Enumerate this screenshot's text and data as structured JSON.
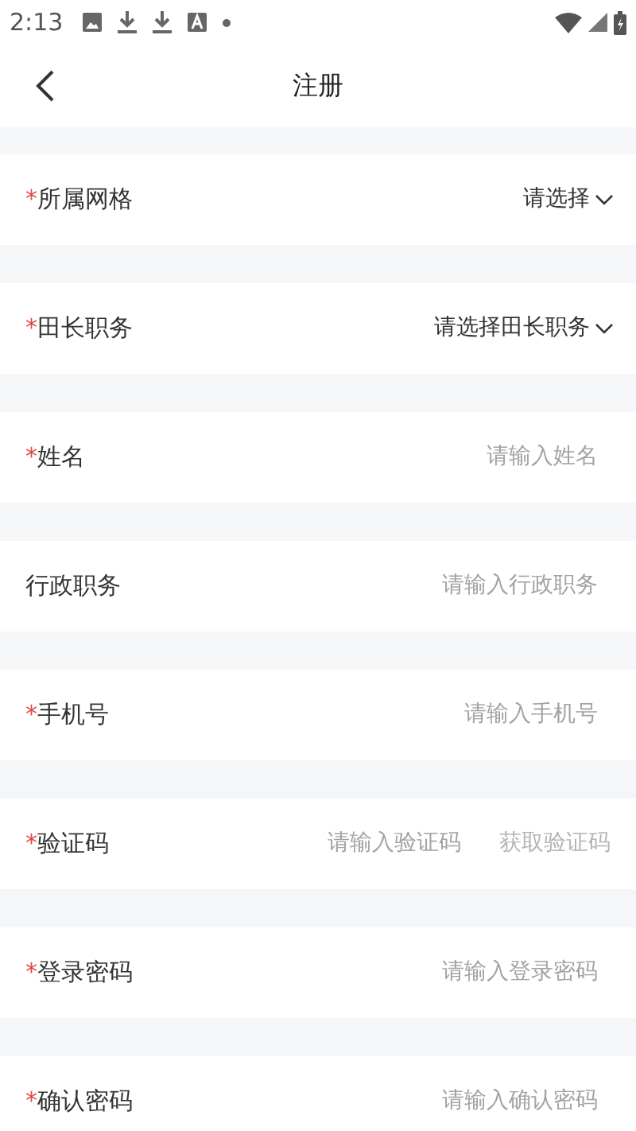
{
  "status_bar": {
    "time": "2:13"
  },
  "header": {
    "title": "注册"
  },
  "fields": [
    {
      "kind": "select",
      "required_mark": "*",
      "label": "所属网格",
      "value": "请选择"
    },
    {
      "kind": "select",
      "required_mark": "*",
      "label": "田长职务",
      "value": "请选择田长职务"
    },
    {
      "kind": "input",
      "required_mark": "*",
      "label": "姓名",
      "placeholder": "请输入姓名"
    },
    {
      "kind": "input",
      "label": "行政职务",
      "placeholder": "请输入行政职务"
    },
    {
      "kind": "input",
      "required_mark": "*",
      "label": "手机号",
      "placeholder": "请输入手机号"
    },
    {
      "kind": "code",
      "required_mark": "*",
      "label": "验证码",
      "placeholder": "请输入验证码",
      "button": "获取验证码"
    },
    {
      "kind": "input",
      "required_mark": "*",
      "label": "登录密码",
      "placeholder": "请输入登录密码"
    },
    {
      "kind": "input",
      "required_mark": "*",
      "label": "确认密码",
      "placeholder": "请输入确认密码"
    }
  ]
}
